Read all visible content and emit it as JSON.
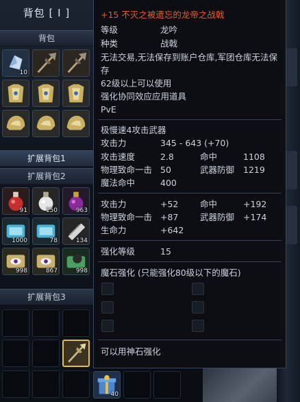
{
  "inventory": {
    "title": "背包 [ I ]",
    "sections": {
      "main": "背包",
      "ext1": "扩展背包1",
      "ext2": "扩展背包2",
      "ext3": "扩展背包3"
    },
    "main_slots": [
      {
        "icon": "crystal-icon",
        "qty": "10"
      },
      {
        "icon": "polearm-icon",
        "qty": ""
      },
      {
        "icon": "polearm-icon",
        "qty": ""
      },
      {
        "icon": "gold-armor-icon",
        "qty": ""
      },
      {
        "icon": "gold-armor-icon",
        "qty": ""
      },
      {
        "icon": "gold-armor-icon",
        "qty": ""
      },
      {
        "icon": "gold-helm-icon",
        "qty": ""
      },
      {
        "icon": "gold-helm-icon",
        "qty": ""
      },
      {
        "icon": "gold-helm-icon",
        "qty": ""
      }
    ],
    "ext2_slots": [
      {
        "icon": "red-potion-icon",
        "qty": "91"
      },
      {
        "icon": "white-potion-icon",
        "qty": "150"
      },
      {
        "icon": "purple-potion-icon",
        "qty": "963"
      },
      {
        "icon": "blue-scroll-icon",
        "qty": "1000"
      },
      {
        "icon": "blue-scroll-icon",
        "qty": "78"
      },
      {
        "icon": "paper-scroll-icon",
        "qty": "134"
      },
      {
        "icon": "eye-scroll-icon",
        "qty": "998"
      },
      {
        "icon": "eye-scroll-icon",
        "qty": "867"
      },
      {
        "icon": "bomb-scroll-icon",
        "qty": "998"
      }
    ],
    "bottom_item": {
      "icon": "gift-box-icon",
      "qty": "40"
    }
  },
  "tooltip": {
    "name": "+15 不灭之被遗忘的龙帝之战戟",
    "level_label": "等级",
    "level_value": "龙吟",
    "type_label": "种类",
    "type_value": "战戟",
    "restriction": "无法交易,无法保存到账户仓库,军团仓库无法保存",
    "level_req": "62级以上可以使用",
    "enhance_item": "强化协同效应应用道具",
    "pve": "PvE",
    "weapon_speed": "极慢速4攻击武器",
    "stats": {
      "atk_label": "攻击力",
      "atk_value": "345 - 643 (+70)",
      "spd_label": "攻击速度",
      "spd_value": "2.8",
      "acc_label": "命中",
      "acc_value": "1108",
      "crit_label": "物理致命一击",
      "crit_value": "50",
      "parry_label": "武器防御",
      "parry_value": "1219",
      "macc_label": "魔法命中",
      "macc_value": "400"
    },
    "bonus": {
      "atk_label": "攻击力",
      "atk_value": "+52",
      "acc_label": "命中",
      "acc_value": "+192",
      "crit_label": "物理致命一击",
      "crit_value": "+87",
      "parry_label": "武器防御",
      "parry_value": "+174",
      "hp_label": "生命力",
      "hp_value": "+642"
    },
    "enchant_label": "强化等级",
    "enchant_value": "15",
    "manastone_label": "魔石强化 (只能强化80级以下的魔石)",
    "godstone": "可以用神石强化"
  }
}
